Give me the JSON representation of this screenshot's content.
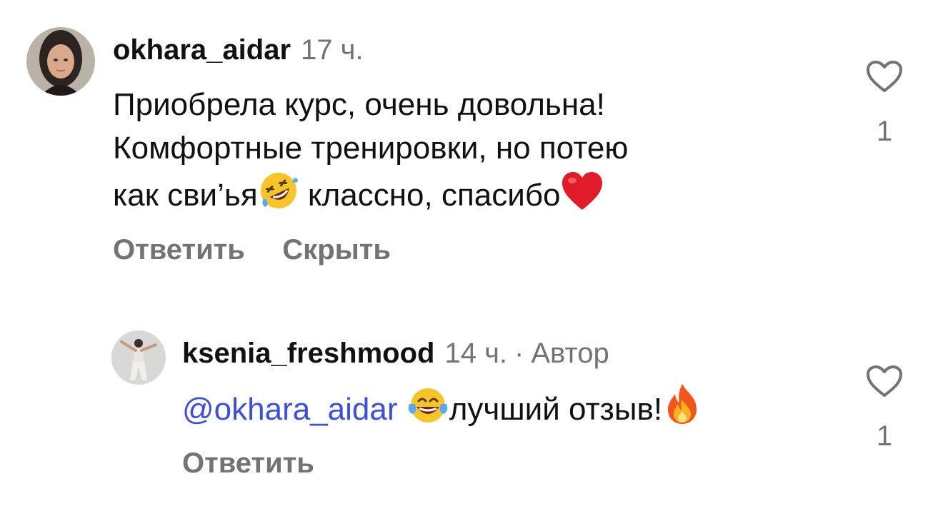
{
  "comments": [
    {
      "username": "okhara_aidar",
      "time": "17 ч.",
      "text_line1": "Приобрела курс, очень довольна!",
      "text_line2": "Комфортные тренировки, но потею",
      "text_line3a": "как сви’ья",
      "text_line3b": " классно, спасибо",
      "emoji_laugh": "rolling-on-floor-laughing-emoji",
      "emoji_heart": "red-heart-emoji",
      "reply_label": "Ответить",
      "hide_label": "Скрыть",
      "likes": "1"
    },
    {
      "username": "ksenia_freshmood",
      "time": "14 ч.",
      "separator": "·",
      "author_badge": "Автор",
      "mention": "@okhara_aidar",
      "text": "лучший отзыв!",
      "emoji_tears": "face-with-tears-of-joy-emoji",
      "emoji_fire": "fire-emoji",
      "reply_label": "Ответить",
      "likes": "1"
    }
  ],
  "colors": {
    "text": "#111111",
    "muted": "#737373",
    "mention": "#3d4fd6"
  }
}
